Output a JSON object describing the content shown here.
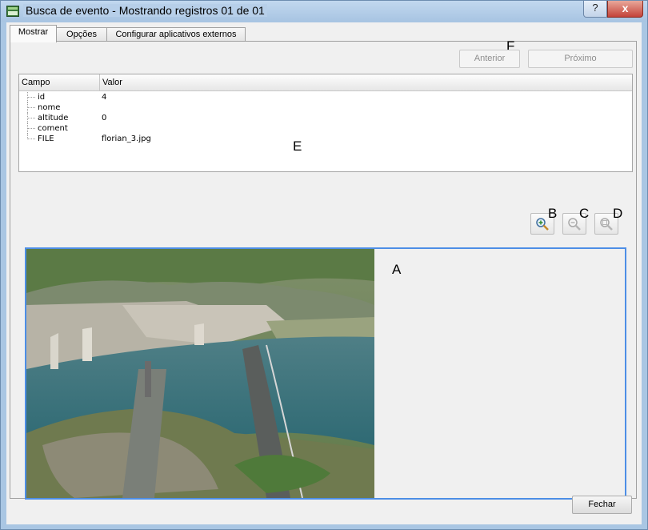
{
  "window": {
    "title": "Busca de evento  - Mostrando registros 01 de 01",
    "help_label": "?",
    "close_label": "x"
  },
  "tabs": [
    {
      "label": "Mostrar",
      "active": true
    },
    {
      "label": "Opções",
      "active": false
    },
    {
      "label": "Configurar aplicativos externos",
      "active": false
    }
  ],
  "nav": {
    "previous_label": "Anterior",
    "next_label": "Próximo"
  },
  "table": {
    "headers": [
      "Campo",
      "Valor"
    ],
    "rows": [
      {
        "field": "id",
        "value": "4"
      },
      {
        "field": "nome",
        "value": ""
      },
      {
        "field": "altitude",
        "value": "0"
      },
      {
        "field": "coment",
        "value": ""
      },
      {
        "field": "FILE",
        "value": "florian_3.jpg"
      }
    ]
  },
  "zoom_buttons": [
    {
      "icon": "zoom-in-icon",
      "enabled": true
    },
    {
      "icon": "zoom-out-icon",
      "enabled": false
    },
    {
      "icon": "zoom-full-icon",
      "enabled": false
    }
  ],
  "annotations": {
    "a": "A",
    "b": "B",
    "c": "C",
    "d": "D",
    "e": "E",
    "f": "F"
  },
  "image": {
    "description_icon": "aerial-city-photo"
  },
  "footer": {
    "close_label": "Fechar"
  },
  "colors": {
    "accent_border": "#4d8ee6",
    "close_button": "#c4433a",
    "titlebar": "#b7cfe9"
  }
}
